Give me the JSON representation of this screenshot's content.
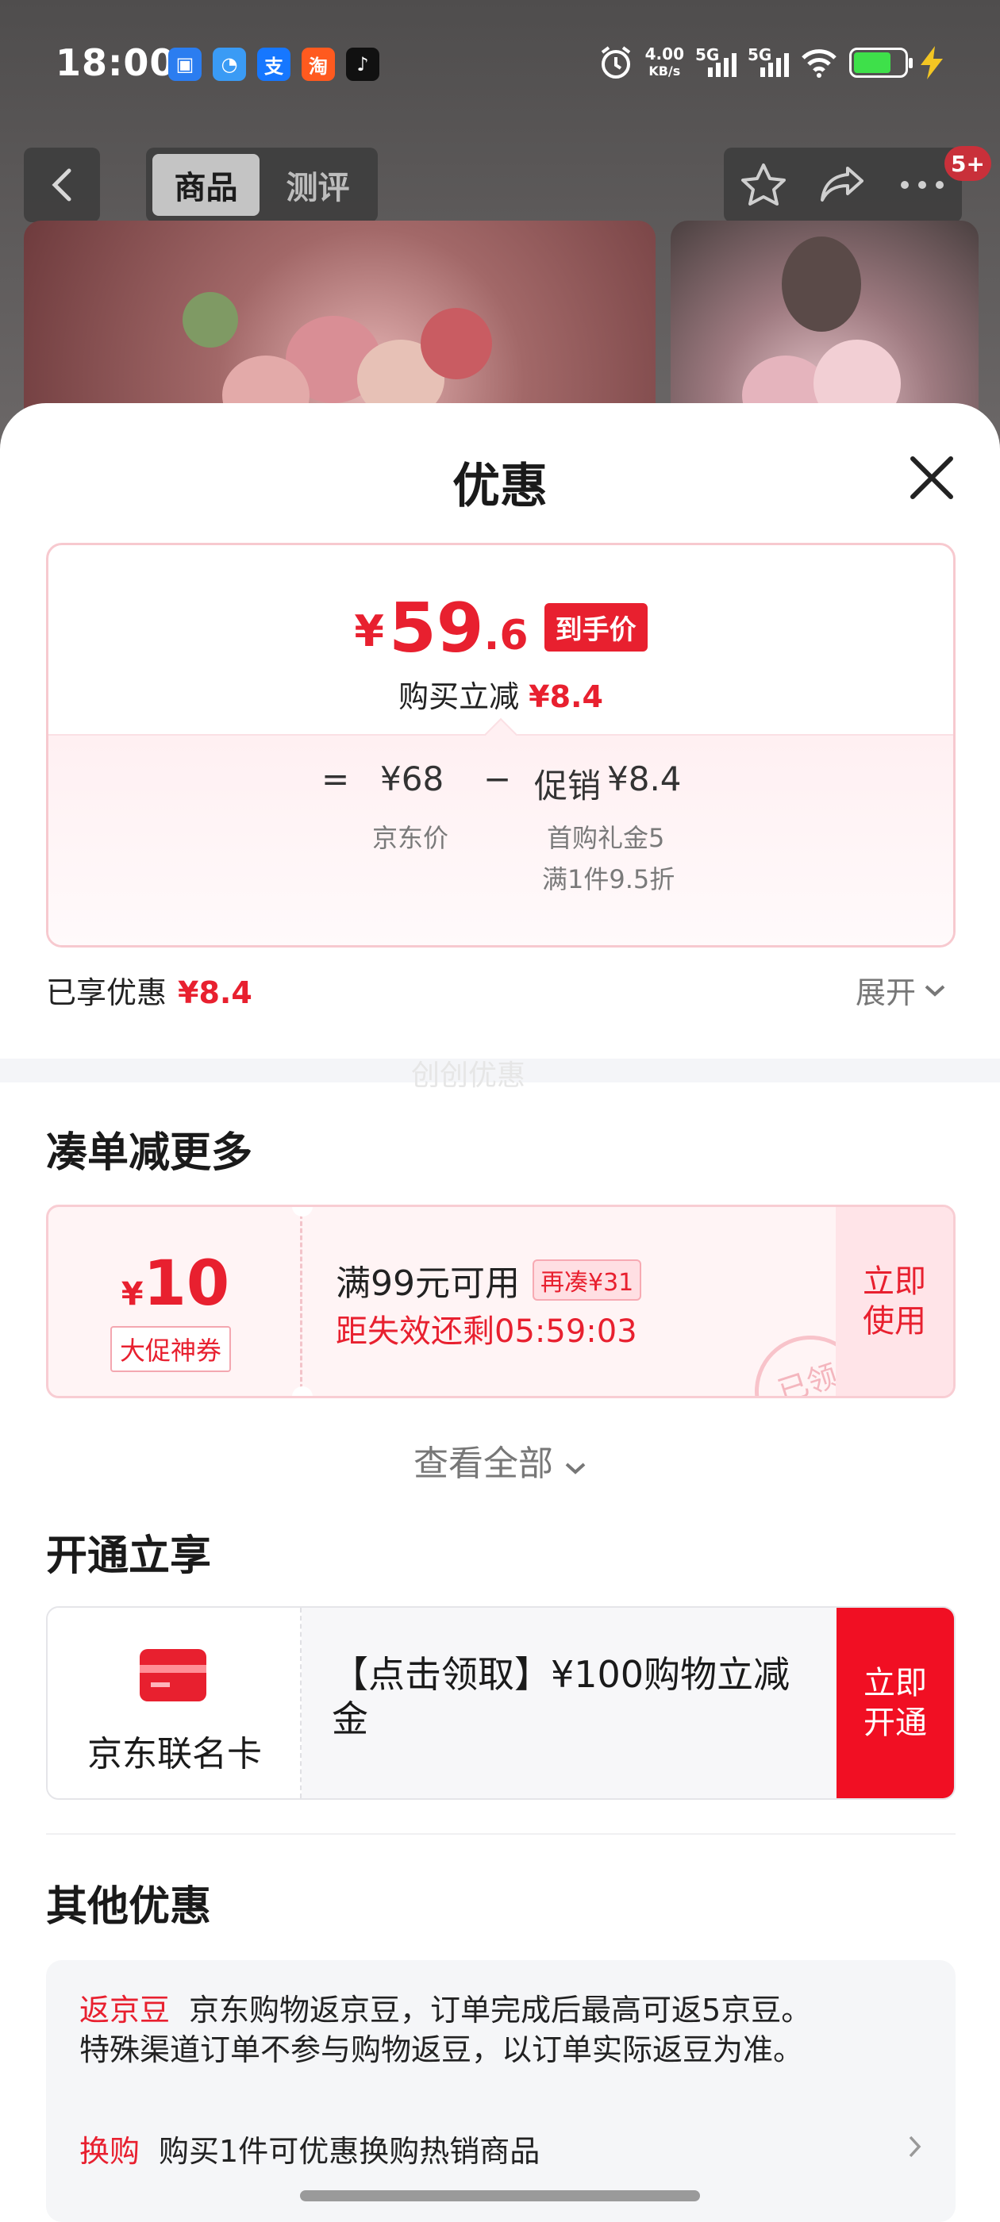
{
  "status_bar": {
    "time": "18:00",
    "apps": [
      {
        "name": "app-icon-1",
        "glyph": "",
        "color": "#2b7df0"
      },
      {
        "name": "app-icon-2",
        "glyph": "",
        "color": "#3a9bf5"
      },
      {
        "name": "alipay-icon",
        "glyph": "支",
        "color": "#1677ff"
      },
      {
        "name": "taobao-icon",
        "glyph": "淘",
        "color": "#ff5a1f"
      },
      {
        "name": "tiktok-icon",
        "glyph": "♪",
        "color": "#111111"
      }
    ],
    "speed_value": "4.00",
    "speed_unit": "KB/s",
    "network_1": "5G",
    "network_2": "5G"
  },
  "nav": {
    "tabs": [
      "商品",
      "测评"
    ],
    "badge": "5+"
  },
  "sheet": {
    "title": "优惠",
    "price": {
      "symbol": "¥",
      "integer": "59",
      "decimal": ".6",
      "tag": "到手价",
      "discount_label": "购买立减",
      "discount_value": "¥8.4",
      "calc": {
        "eq": "=",
        "base_price": "¥68",
        "minus": "−",
        "promo_label": "促销",
        "promo_value": "¥8.4",
        "base_desc": "京东价",
        "promo_desc_1": "首购礼金5",
        "promo_desc_2": "满1件9.5折"
      }
    },
    "saved": {
      "label": "已享优惠",
      "value": "¥8.4",
      "expand": "展开"
    },
    "watermark": "创创优惠",
    "more_section": {
      "title": "凑单减更多",
      "coupon": {
        "symbol": "¥",
        "amount": "10",
        "tag": "大促神券",
        "condition": "满99元可用",
        "extra": "再凑¥31",
        "countdown": "距失效还剩05:59:03",
        "button": "立即使用",
        "stamp": "已领"
      },
      "view_all": "查看全部"
    },
    "open_section": {
      "title": "开通立享",
      "card_name": "京东联名卡",
      "desc": "【点击领取】¥100购物立减金",
      "button": "立即开通"
    },
    "other_section": {
      "title": "其他优惠",
      "items": [
        {
          "tag": "返京豆",
          "text": "京东购物返京豆，订单完成后最高可返5京豆。",
          "text2": "特殊渠道订单不参与购物返豆，以订单实际返豆为准。"
        },
        {
          "tag": "换购",
          "text": "购买1件可优惠换购热销商品"
        }
      ]
    }
  }
}
